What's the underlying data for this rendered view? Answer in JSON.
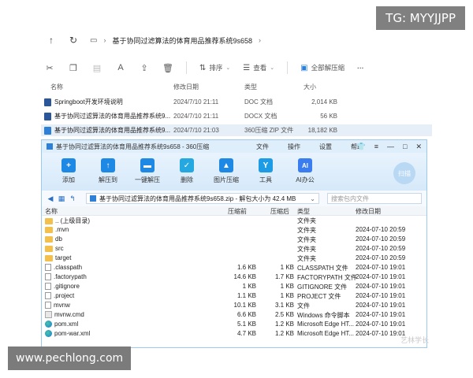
{
  "watermarks": {
    "tg": "TG: MYYJJPP",
    "url": "www.pechlong.com",
    "faint": "艺林学长"
  },
  "explorer": {
    "path": "基于协同过滤算法的体育用品推荐系统9s658",
    "toolbar": {
      "sort_label": "排序",
      "view_label": "查看",
      "extract_all_label": "全部解压缩",
      "more_label": "···"
    },
    "columns": {
      "name": "名称",
      "date": "修改日期",
      "type": "类型",
      "size": "大小"
    },
    "files": [
      {
        "name": "Springboot开发环境说明",
        "date": "2024/7/10 21:11",
        "type": "DOC 文档",
        "size": "2,014 KB",
        "color": "#2b579a"
      },
      {
        "name": "基于协同过滤算法的体育用品推荐系统9...",
        "date": "2024/7/10 21:11",
        "type": "DOCX 文档",
        "size": "56 KB",
        "color": "#2b579a"
      },
      {
        "name": "基于协同过滤算法的体育用品推荐系统9...",
        "date": "2024/7/10 21:03",
        "type": "360压缩 ZIP 文件",
        "size": "18,182 KB",
        "color": "#2e7fd6"
      }
    ]
  },
  "zip": {
    "title": "基于协同过滤算法的体育用品推荐系统9s658 - 360压缩",
    "menu": [
      "文件",
      "操作",
      "设置",
      "帮助"
    ],
    "tools": [
      {
        "label": "添加",
        "glyph": "+"
      },
      {
        "label": "解压到",
        "glyph": "↑"
      },
      {
        "label": "一键解压",
        "glyph": "▬"
      },
      {
        "label": "删除",
        "glyph": "✓"
      },
      {
        "label": "图片压缩",
        "glyph": "▲"
      },
      {
        "label": "工具",
        "glyph": "Y"
      },
      {
        "label": "AI办公",
        "glyph": "AI"
      }
    ],
    "scan_label": "扫描",
    "path": "基于协同过滤算法的体育用品推荐系统9s658.zip - 解包大小为 42.4 MB",
    "search_placeholder": "搜索包内文件",
    "columns": {
      "name": "名称",
      "packed": "压缩前",
      "orig": "压缩后",
      "type": "类型",
      "date": "修改日期"
    },
    "rows": [
      {
        "name": ".. (上级目录)",
        "packed": "",
        "orig": "",
        "type": "文件夹",
        "date": "",
        "kind": "folder"
      },
      {
        "name": ".mvn",
        "packed": "",
        "orig": "",
        "type": "文件夹",
        "date": "2024-07-10 20:59",
        "kind": "folder"
      },
      {
        "name": "db",
        "packed": "",
        "orig": "",
        "type": "文件夹",
        "date": "2024-07-10 20:59",
        "kind": "folder"
      },
      {
        "name": "src",
        "packed": "",
        "orig": "",
        "type": "文件夹",
        "date": "2024-07-10 20:59",
        "kind": "folder"
      },
      {
        "name": "target",
        "packed": "",
        "orig": "",
        "type": "文件夹",
        "date": "2024-07-10 20:59",
        "kind": "folder"
      },
      {
        "name": ".classpath",
        "packed": "1.6 KB",
        "orig": "1 KB",
        "type": "CLASSPATH 文件",
        "date": "2024-07-10 19:01",
        "kind": "file"
      },
      {
        "name": ".factorypath",
        "packed": "14.6 KB",
        "orig": "1.7 KB",
        "type": "FACTORYPATH 文件",
        "date": "2024-07-10 19:01",
        "kind": "file"
      },
      {
        "name": ".gitignore",
        "packed": "1 KB",
        "orig": "1 KB",
        "type": "GITIGNORE 文件",
        "date": "2024-07-10 19:01",
        "kind": "file"
      },
      {
        "name": ".project",
        "packed": "1.1 KB",
        "orig": "1 KB",
        "type": "PROJECT 文件",
        "date": "2024-07-10 19:01",
        "kind": "file"
      },
      {
        "name": "mvnw",
        "packed": "10.1 KB",
        "orig": "3.1 KB",
        "type": "文件",
        "date": "2024-07-10 19:01",
        "kind": "file"
      },
      {
        "name": "mvnw.cmd",
        "packed": "6.6 KB",
        "orig": "2.5 KB",
        "type": "Windows 命令脚本",
        "date": "2024-07-10 19:01",
        "kind": "cmd"
      },
      {
        "name": "pom.xml",
        "packed": "5.1 KB",
        "orig": "1.2 KB",
        "type": "Microsoft Edge HT...",
        "date": "2024-07-10 19:01",
        "kind": "edge"
      },
      {
        "name": "pom-war.xml",
        "packed": "4.7 KB",
        "orig": "1.2 KB",
        "type": "Microsoft Edge HT...",
        "date": "2024-07-10 19:01",
        "kind": "edge"
      }
    ]
  }
}
